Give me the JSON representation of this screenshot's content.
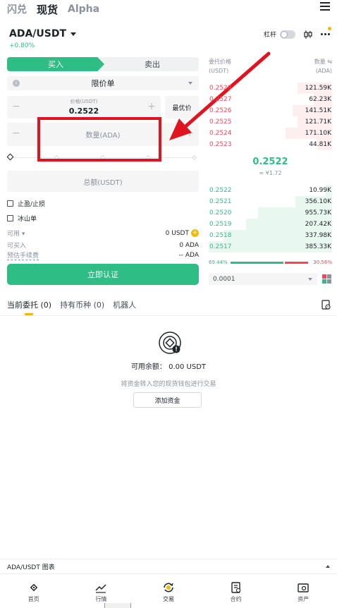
{
  "top_tabs": [
    "闪兑",
    "现货",
    "Alpha"
  ],
  "pair": {
    "name": "ADA/USDT",
    "change": "+0.80%",
    "leverage_label": "杠杆"
  },
  "trade": {
    "buy_label": "买入",
    "sell_label": "卖出",
    "order_type": "限价单",
    "price_label": "价格(USDT)",
    "price_value": "0.2522",
    "best_price_label": "最优价",
    "qty_placeholder": "数量(ADA)",
    "total_placeholder": "总额(USDT)",
    "tp_sl_label": "止盈/止损",
    "iceberg_label": "冰山单",
    "available_label": "可用",
    "available_value": "0 USDT",
    "can_buy_label": "可买入",
    "can_buy_value": "0 ADA",
    "fee_label": "预估手续费",
    "fee_value": "-- ADA",
    "submit_label": "立即认证",
    "minus_glyph": "−",
    "plus_glyph": "+"
  },
  "order_book": {
    "price_header": "委托价格",
    "price_unit": "(USDT)",
    "qty_header": "数量",
    "qty_unit": "(ADA)",
    "asks": [
      {
        "price": "0.2528",
        "qty": "121.59K",
        "depth": 0.28
      },
      {
        "price": "0.2527",
        "qty": "62.23K",
        "depth": 0.15
      },
      {
        "price": "0.2526",
        "qty": "141.51K",
        "depth": 0.32
      },
      {
        "price": "0.2525",
        "qty": "121.71K",
        "depth": 0.28
      },
      {
        "price": "0.2524",
        "qty": "171.10K",
        "depth": 0.38
      },
      {
        "price": "0.2523",
        "qty": "44.81K",
        "depth": 0.12
      }
    ],
    "mid_price": "0.2522",
    "mid_fiat": "≈ ¥1.72",
    "bids": [
      {
        "price": "0.2522",
        "qty": "10.99K",
        "depth": 0.05
      },
      {
        "price": "0.2521",
        "qty": "356.10K",
        "depth": 0.3
      },
      {
        "price": "0.2520",
        "qty": "955.73K",
        "depth": 0.6
      },
      {
        "price": "0.2519",
        "qty": "207.42K",
        "depth": 0.7
      },
      {
        "price": "0.2518",
        "qty": "337.98K",
        "depth": 0.88
      },
      {
        "price": "0.2517",
        "qty": "385.33K",
        "depth": 1.0
      }
    ],
    "buy_ratio": "69.44%",
    "sell_ratio": "30.56%",
    "buy_ratio_value": 0.6944,
    "step": "0.0001"
  },
  "orders": {
    "tabs": [
      "当前委托 (0)",
      "持有币种 (0)",
      "机器人"
    ],
    "available_balance": "可用余额：  0.00 USDT",
    "hint": "将资金转入您的现货钱包进行交易",
    "add_funds_label": "添加资金"
  },
  "chart_bar_label": "ADA/USDT 图表",
  "nav": [
    "首页",
    "行情",
    "交易",
    "合约",
    "资产"
  ],
  "colors": {
    "green": "#2ebd85",
    "red": "#f6465d",
    "accent": "#f0b90b",
    "annotation": "#e0141e"
  }
}
